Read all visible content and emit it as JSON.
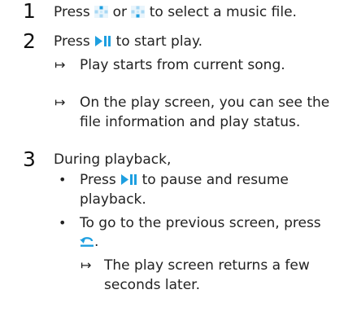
{
  "steps": [
    {
      "number": "1",
      "parts": [
        "Press",
        "or",
        "to select a music file."
      ]
    },
    {
      "number": "2",
      "parts": [
        "Press",
        "to start play."
      ],
      "results": [
        "Play starts from current song.",
        "On the play screen, you can see the",
        "file information and play status."
      ]
    },
    {
      "number": "3",
      "intro": "During playback,",
      "bullets": [
        {
          "lines": [
            "Press",
            "to pause and resume",
            "playback."
          ]
        },
        {
          "lines": [
            "To go to the previous screen, press",
            "."
          ],
          "result": [
            "The play screen returns a few",
            "seconds later."
          ]
        }
      ]
    }
  ],
  "symbols": {
    "arrow": "↦",
    "bullet": "•"
  },
  "colors": {
    "icon_blue": "#1e9fe0",
    "icon_light": "#a8d8f3",
    "text": "#222222"
  },
  "icons": {
    "up_button": "dpad-up-icon",
    "down_button": "dpad-down-icon",
    "play_pause": "play-pause-icon",
    "back": "back-icon"
  }
}
